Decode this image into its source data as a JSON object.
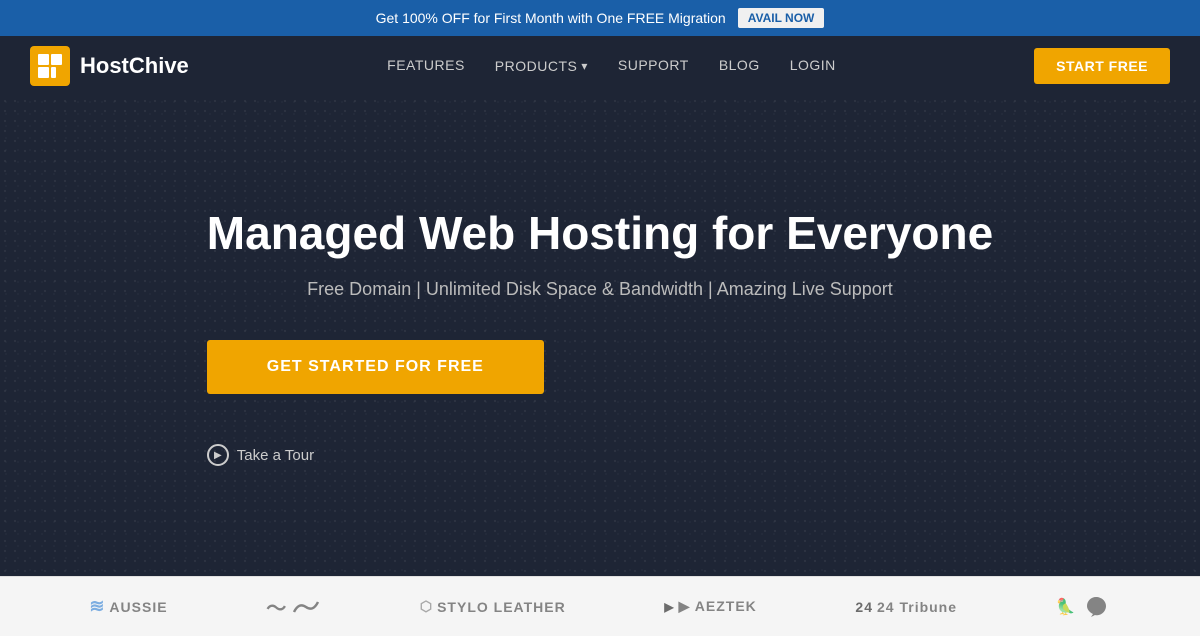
{
  "announcement": {
    "text": "Get 100% OFF for First Month with One FREE Migration",
    "button_label": "AVAIL NOW"
  },
  "navbar": {
    "logo_text": "HostChive",
    "nav_items": [
      {
        "label": "FEATURES",
        "has_dropdown": false
      },
      {
        "label": "PRODUCTS",
        "has_dropdown": true
      },
      {
        "label": "SUPPORT",
        "has_dropdown": false
      },
      {
        "label": "BLOG",
        "has_dropdown": false
      },
      {
        "label": "LOGIN",
        "has_dropdown": false
      }
    ],
    "cta_label": "START FREE"
  },
  "hero": {
    "title": "Managed Web Hosting for Everyone",
    "subtitle": "Free Domain | Unlimited Disk Space & Bandwidth | Amazing Live Support",
    "cta_label": "GET STARTED FOR FREE",
    "tour_label": "Take a Tour"
  },
  "brands": [
    {
      "name": "AUSSIE",
      "style": "aussie"
    },
    {
      "name": "",
      "style": "wave"
    },
    {
      "name": "STYLO LEATHER",
      "style": "stylo"
    },
    {
      "name": "AEZTEK",
      "style": "aztek"
    },
    {
      "name": "Tribune",
      "style": "tribune"
    },
    {
      "name": "",
      "style": "bird"
    }
  ]
}
